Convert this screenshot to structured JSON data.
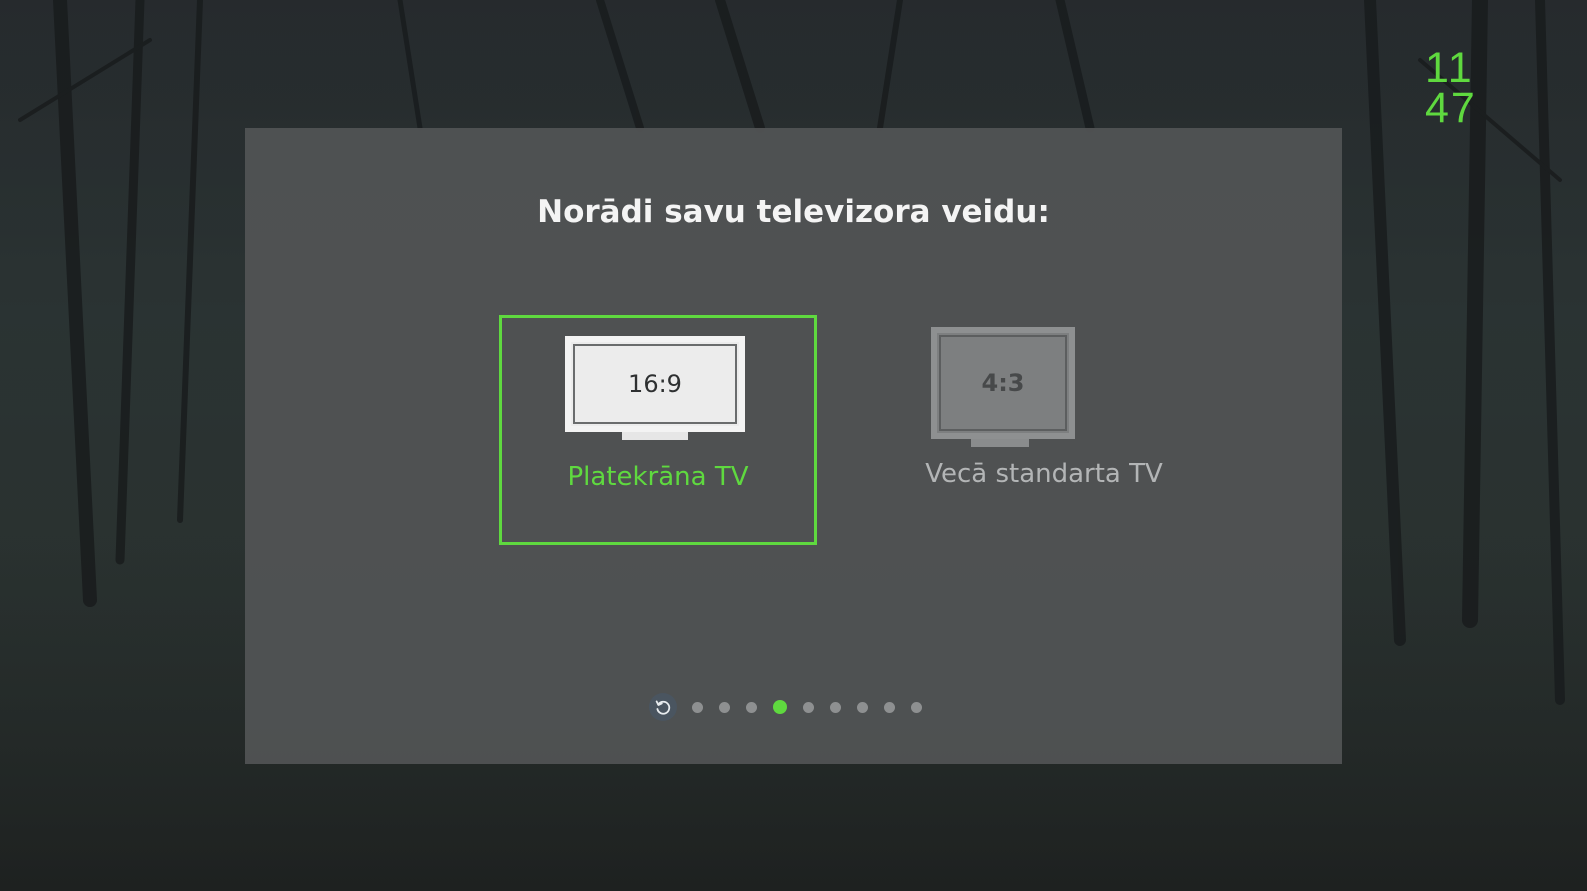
{
  "clock": {
    "hours": "11",
    "minutes": "47"
  },
  "dialog": {
    "title": "Norādi savu televizora veidu:",
    "options": [
      {
        "screen_text": "16:9",
        "label": "Platekrāna TV",
        "selected": true
      },
      {
        "screen_text": "4:3",
        "label": "Vecā standarta TV",
        "selected": false
      }
    ]
  },
  "pager": {
    "reset_icon": "refresh-icon",
    "total_steps": 9,
    "active_step": 4
  },
  "colors": {
    "accent": "#5fd93f",
    "panel": "#525455",
    "dot_inactive": "#8e9091"
  }
}
